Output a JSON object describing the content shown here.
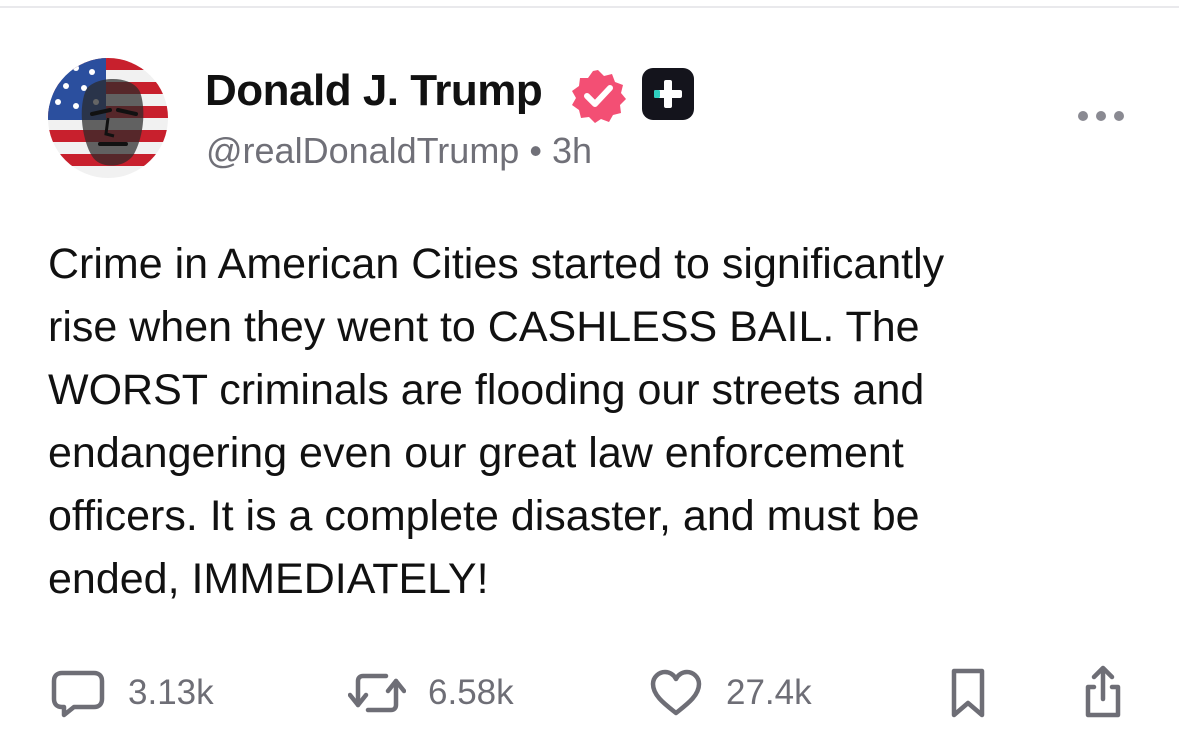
{
  "post": {
    "author": {
      "display_name": "Donald J. Trump",
      "handle": "@realDonaldTrump",
      "time_ago": "3h",
      "verified_color": "#f34f74",
      "plus_badge_color": "#14141c",
      "plus_badge_accent": "#2fd0c0"
    },
    "separator": "•",
    "text": "Crime in American Cities started to significantly\nrise when they went to CASHLESS BAIL. The\nWORST criminals are flooding our streets and\nendangering even our great law enforcement\nofficers. It is a complete disaster, and must be\nended, IMMEDIATELY!",
    "actions": {
      "replies": {
        "count": "3.13k",
        "icon": "comment-icon"
      },
      "reposts": {
        "count": "6.58k",
        "icon": "repost-icon"
      },
      "likes": {
        "count": "27.4k",
        "icon": "heart-icon"
      },
      "bookmark": {
        "icon": "bookmark-icon"
      },
      "share": {
        "icon": "share-icon"
      }
    }
  }
}
